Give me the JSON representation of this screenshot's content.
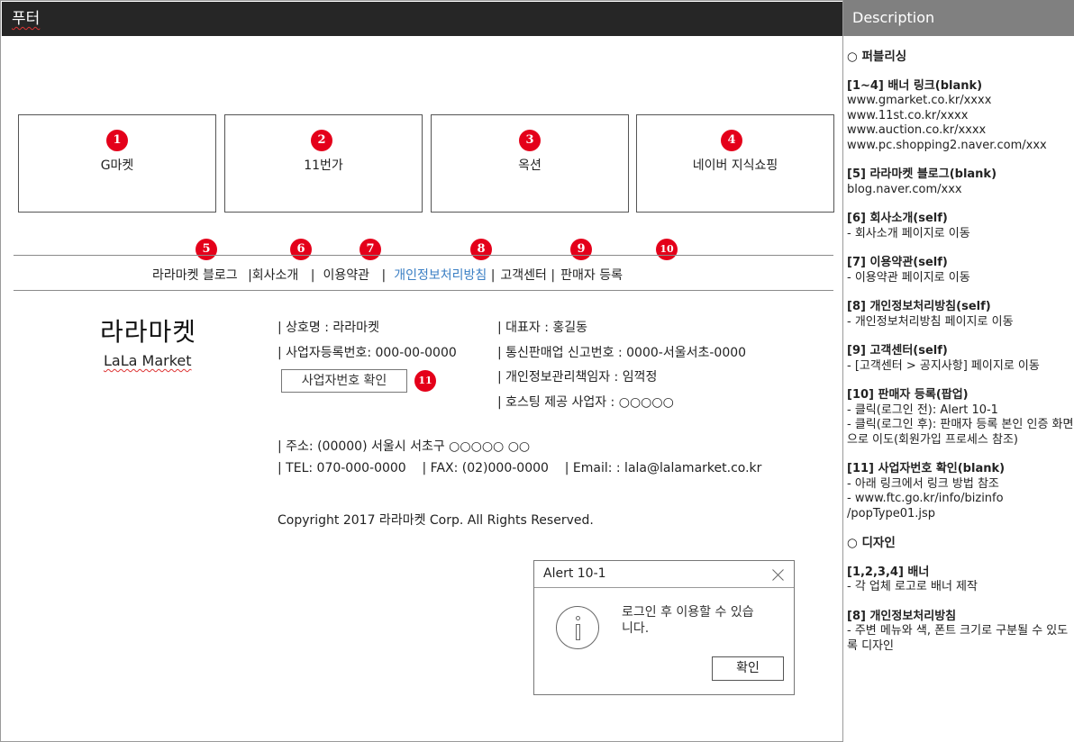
{
  "topbar": {
    "title": "푸터"
  },
  "banners": [
    {
      "num": "1",
      "label": "G마켓"
    },
    {
      "num": "2",
      "label": "11번가"
    },
    {
      "num": "3",
      "label": "옥션"
    },
    {
      "num": "4",
      "label": "네이버 지식쇼핑"
    }
  ],
  "footnav": {
    "nums": [
      "5",
      "6",
      "7",
      "8",
      "9",
      "10"
    ],
    "blog": "라라마켓 블로그",
    "sep1": "|",
    "company": "회사소개",
    "sep2": "|",
    "terms": "이용약관",
    "sep3": "|",
    "privacy": "개인정보처리방침",
    "sep4": "|",
    "support": "고객센터",
    "sep5": "|",
    "seller": "판매자 등록"
  },
  "logo": {
    "ko": "라라마켓",
    "en": "LaLa Market"
  },
  "company_info": {
    "name": "| 상호명 : 라라마켓",
    "reg_no": "| 사업자등록번호: 000-00-0000",
    "ceo": "| 대표자 : 홍길동",
    "mail_order": "| 통신판매업 신고번호 : 0000-서울서초-0000",
    "privacy_officer": "| 개인정보관리책임자 : 임꺽정",
    "hosting": "| 호스팅 제공 사업자 : ○○○○○",
    "address": "| 주소: (00000) 서울시 서초구 ○○○○○ ○○",
    "contact": "| TEL: 070-000-0000    | FAX: (02)000-0000    | Email: : lala@lalamarket.co.kr",
    "copyright": "Copyright 2017 라라마켓 Corp. All Rights Reserved."
  },
  "biz_button": {
    "label": "사업자번호 확인",
    "num": "11"
  },
  "alert": {
    "title": "Alert 10-1",
    "message": "로그인 후 이용할 수 있습니다.",
    "ok": "확인"
  },
  "description": {
    "header": "Description",
    "publishing": "○ 퍼블리싱",
    "i1_title": "[1~4] 배너 링크(blank)",
    "i1_l1": "www.gmarket.co.kr/xxxx",
    "i1_l2": "www.11st.co.kr/xxxx",
    "i1_l3": "www.auction.co.kr/xxxx",
    "i1_l4": "www.pc.shopping2.naver.com/xxx",
    "i5_title": "[5] 라라마켓 블로그(blank)",
    "i5_l1": "blog.naver.com/xxx",
    "i6_title": "[6] 회사소개(self)",
    "i6_l1": "- 회사소개 페이지로 이동",
    "i7_title": "[7] 이용약관(self)",
    "i7_l1": "- 이용약관 페이지로 이동",
    "i8_title": "[8] 개인정보처리방침(self)",
    "i8_l1": "-  개인정보처리방침 페이지로 이동",
    "i9_title": "[9] 고객센터(self)",
    "i9_l1": "- [고객센터 > 공지사항] 페이지로 이동",
    "i10_title": "[10] 판매자 등록(팝업)",
    "i10_l1": "- 클릭(로그인 전): Alert 10-1",
    "i10_l2": "- 클릭(로그인 후): 판매자 등록 본인 인증 화면으로 이도(회원가입 프로세스 참조)",
    "i11_title": "[11] 사업자번호 확인(blank)",
    "i11_l1": "- 아래 링크에서 링크 방법 참조",
    "i11_l2": "- www.ftc.go.kr/info/bizinfo /popType01.jsp",
    "design": "○ 디자인",
    "d1_title": "[1,2,3,4] 배너",
    "d1_l1": "- 각 업체 로고로 배너 제작",
    "d8_title": "[8] 개인정보처리방침",
    "d8_l1": "- 주변 메뉴와 색, 폰트 크기로 구분될 수 있도록 디자인"
  }
}
